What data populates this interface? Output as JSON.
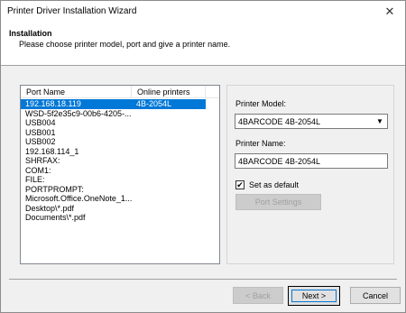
{
  "window": {
    "title": "Printer Driver Installation Wizard",
    "close_glyph": "✕"
  },
  "header": {
    "title": "Installation",
    "subtitle": "Please choose printer model, port and give a printer name."
  },
  "port_list": {
    "columns": [
      "Port Name",
      "Online printers"
    ],
    "rows": [
      {
        "port": "192.168.18.119",
        "printer": "4B-2054L",
        "selected": true
      },
      {
        "port": "WSD-5f2e35c9-00b6-4205-...",
        "printer": ""
      },
      {
        "port": "USB004",
        "printer": ""
      },
      {
        "port": "USB001",
        "printer": ""
      },
      {
        "port": "USB002",
        "printer": ""
      },
      {
        "port": "192.168.114_1",
        "printer": ""
      },
      {
        "port": "SHRFAX:",
        "printer": ""
      },
      {
        "port": "COM1:",
        "printer": ""
      },
      {
        "port": "FILE:",
        "printer": ""
      },
      {
        "port": "PORTPROMPT:",
        "printer": ""
      },
      {
        "port": "Microsoft.Office.OneNote_1...",
        "printer": ""
      },
      {
        "port": "Desktop\\*.pdf",
        "printer": ""
      },
      {
        "port": "Documents\\*.pdf",
        "printer": ""
      }
    ]
  },
  "settings": {
    "model_label": "Printer Model:",
    "model_value": "4BARCODE 4B-2054L",
    "name_label": "Printer Name:",
    "name_value": "4BARCODE 4B-2054L",
    "default_label": "Set as default",
    "default_checked": "✔",
    "port_settings_label": "Port Settings"
  },
  "footer": {
    "back_label": "< Back",
    "next_label": "Next >",
    "cancel_label": "Cancel"
  },
  "colors": {
    "selection": "#0078d7",
    "dialog_bg": "#f0f0f0"
  }
}
